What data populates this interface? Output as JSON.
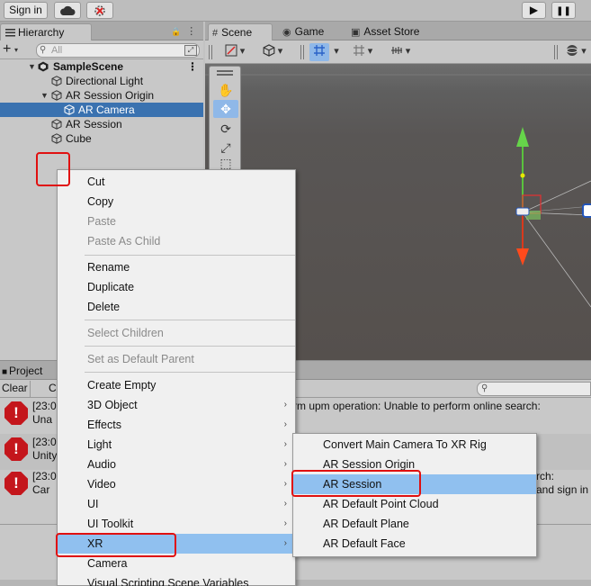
{
  "toolbar": {
    "sign_in": "Sign in",
    "cloud_icon": "cloud-icon",
    "collab_icon": "collab-icon",
    "play_icon": "▶",
    "pause_icon": "❚❚"
  },
  "hierarchy": {
    "tab_label": "Hierarchy",
    "tab_lock": "🔒",
    "tab_menu": "⋮",
    "add_label": "+",
    "add_caret": "▾",
    "search_placeholder": "All",
    "search_icon": "🔍",
    "items": [
      {
        "label": "SampleScene",
        "dots": "⋮"
      },
      {
        "label": "Directional Light"
      },
      {
        "label": "AR Session Origin"
      },
      {
        "label": "AR Camera"
      },
      {
        "label": "AR Session"
      },
      {
        "label": "Cube"
      }
    ],
    "selected_item": "AR Camera"
  },
  "scene": {
    "tabs": [
      {
        "label": "Scene",
        "icon": "#"
      },
      {
        "label": "Game",
        "icon": "◉"
      },
      {
        "label": "Asset Store",
        "icon": "▣"
      }
    ],
    "active_tab": "Scene"
  },
  "console": {
    "tab_label": "Project",
    "clear_label": "Clear",
    "collapse_label": "C",
    "search_icon": "🔍",
    "rows": [
      {
        "l1": "[23:0",
        "l2": "Una",
        "right1": "rm upm operation: Unable to perform online search:",
        "right2": ""
      },
      {
        "l1": "[23:0",
        "l2": "Unity",
        "right1": "",
        "right2": ""
      },
      {
        "l1": "[23:0",
        "l2": "Car",
        "right1": "rch:",
        "right2": "and sign in a"
      }
    ]
  },
  "context_menu": {
    "items": [
      {
        "label": "Cut"
      },
      {
        "label": "Copy"
      },
      {
        "label": "Paste",
        "disabled": true
      },
      {
        "label": "Paste As Child",
        "disabled": true
      },
      {
        "label": "Rename"
      },
      {
        "label": "Duplicate"
      },
      {
        "label": "Delete"
      },
      {
        "label": "Select Children",
        "disabled": true
      },
      {
        "label": "Set as Default Parent",
        "disabled": true
      },
      {
        "label": "Create Empty"
      },
      {
        "label": "3D Object"
      },
      {
        "label": "Effects"
      },
      {
        "label": "Light"
      },
      {
        "label": "Audio"
      },
      {
        "label": "Video"
      },
      {
        "label": "UI"
      },
      {
        "label": "UI Toolkit"
      },
      {
        "label": "XR"
      },
      {
        "label": "Camera"
      },
      {
        "label": "Visual Scripting Scene Variables"
      }
    ],
    "highlighted": "XR",
    "submenu_arrow": "›"
  },
  "xr_submenu": {
    "items": [
      {
        "label": "Convert Main Camera To XR Rig"
      },
      {
        "label": "AR Session Origin"
      },
      {
        "label": "AR Session"
      },
      {
        "label": "AR Default Point Cloud"
      },
      {
        "label": "AR Default Plane"
      },
      {
        "label": "AR Default Face"
      }
    ],
    "highlighted": "AR Session"
  },
  "colors": {
    "annotation": "#e01010",
    "menu_highlight": "#90c0ef",
    "selection": "#3a72b0",
    "error": "#c4161c"
  }
}
